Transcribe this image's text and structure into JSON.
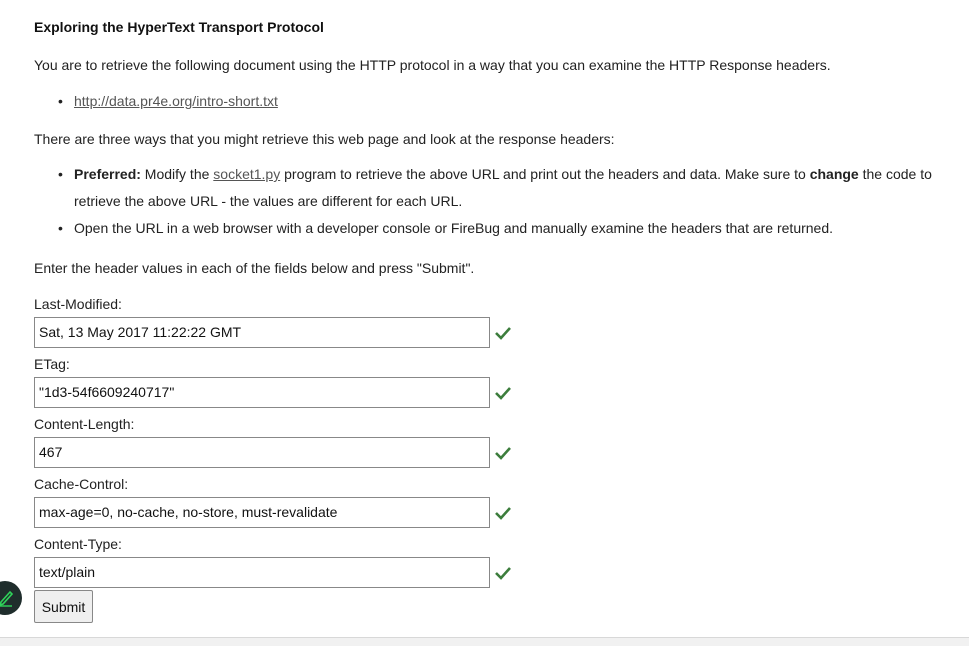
{
  "title": "Exploring the HyperText Transport Protocol",
  "intro": "You are to retrieve the following document using the HTTP protocol in a way that you can examine the HTTP Response headers.",
  "doc_link": "http://data.pr4e.org/intro-short.txt",
  "ways_intro": "There are three ways that you might retrieve this web page and look at the response headers:",
  "bullets": {
    "preferred_label": "Preferred:",
    "preferred_pre": " Modify the ",
    "socket_link": "socket1.py",
    "preferred_mid": " program to retrieve the above URL and print out the headers and data. Make sure to ",
    "change_word": "change",
    "preferred_post": " the code to",
    "preferred_line2": "retrieve the above URL - the values are different for each URL.",
    "browser": "Open the URL in a web browser with a developer console or FireBug and manually examine the headers that are returned."
  },
  "instructions": "Enter the header values in each of the fields below and press \"Submit\".",
  "fields": [
    {
      "label": "Last-Modified:",
      "value": "Sat, 13 May 2017 11:22:22 GMT"
    },
    {
      "label": "ETag:",
      "value": "\"1d3-54f6609240717\""
    },
    {
      "label": "Content-Length:",
      "value": "467"
    },
    {
      "label": "Cache-Control:",
      "value": "max-age=0, no-cache, no-store, must-revalidate"
    },
    {
      "label": "Content-Type:",
      "value": "text/plain"
    }
  ],
  "submit_label": "Submit",
  "colors": {
    "check": "#3c7d3c",
    "link": "#555555"
  },
  "icons": {
    "check": "check-icon",
    "edit": "pencil-icon"
  }
}
